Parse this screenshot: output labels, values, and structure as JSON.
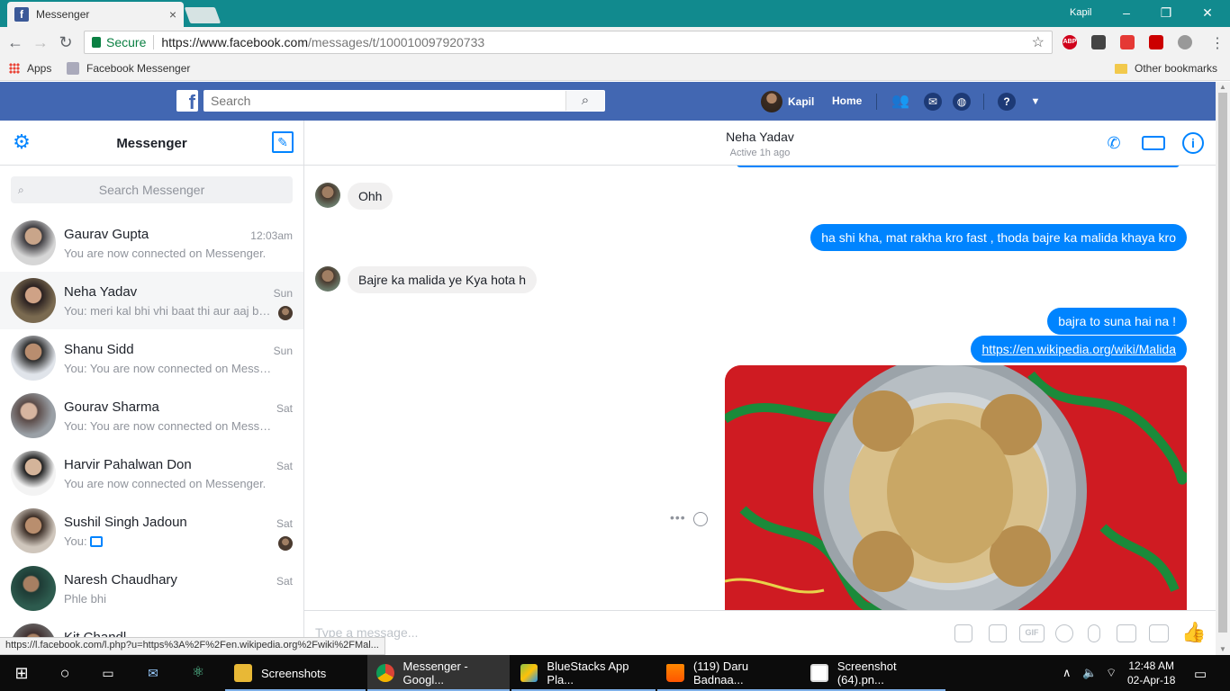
{
  "browser": {
    "tab_title": "Messenger",
    "tab_close": "×",
    "favicon": "f",
    "window_user": "Kapil",
    "secure_label": "Secure",
    "url_host": "https://www.facebook.com",
    "url_path": "/messages/t/100010097920733",
    "ext_abp": "ABP",
    "bookmarks": {
      "apps": "Apps",
      "messenger": "Facebook Messenger",
      "other": "Other bookmarks"
    }
  },
  "fb": {
    "logo": "f",
    "search_placeholder": "Search",
    "user_name": "Kapil",
    "home": "Home"
  },
  "sidebar": {
    "title": "Messenger",
    "search_placeholder": "Search Messenger",
    "conversations": [
      {
        "name": "Gaurav Gupta",
        "time": "12:03am",
        "snippet": "You are now connected on Messenger."
      },
      {
        "name": "Neha Yadav",
        "time": "Sun",
        "snippet": "You: meri kal bhi vhi baat thi aur aaj bhi..."
      },
      {
        "name": "Shanu Sidd",
        "time": "Sun",
        "snippet": "You: You are now connected on Messenger."
      },
      {
        "name": "Gourav Sharma",
        "time": "Sat",
        "snippet": "You: You are now connected on Messenger."
      },
      {
        "name": "Harvir Pahalwan Don",
        "time": "Sat",
        "snippet": "You are now connected on Messenger."
      },
      {
        "name": "Sushil Singh Jadoun",
        "time": "Sat",
        "snippet": "You:"
      },
      {
        "name": "Naresh Chaudhary",
        "time": "Sat",
        "snippet": "Phle bhi"
      },
      {
        "name": "Kit Chandl...",
        "time": "",
        "snippet": ""
      }
    ]
  },
  "chat": {
    "contact_name": "Neha Yadav",
    "status": "Active 1h ago",
    "messages": [
      {
        "dir": "in",
        "text": "Ohh"
      },
      {
        "dir": "out",
        "text": "ha shi kha, mat rakha kro fast , thoda bajre ka malida  khaya kro"
      },
      {
        "dir": "in",
        "text": "Bajre ka malida ye Kya hota h"
      },
      {
        "dir": "out",
        "text": "bajra to suna hai na !"
      },
      {
        "dir": "out",
        "text": "https://en.wikipedia.org/wiki/Malida"
      }
    ],
    "composer_placeholder": "Type a message...",
    "gif_label": "GIF"
  },
  "status_link": "https://l.facebook.com/l.php?u=https%3A%2F%2Fen.wikipedia.org%2Fwiki%2FMal...",
  "taskbar": {
    "apps": [
      {
        "label": "Screenshots"
      },
      {
        "label": "Messenger - Googl..."
      },
      {
        "label": "BlueStacks App Pla..."
      },
      {
        "label": "(119) Daru Badnaa..."
      },
      {
        "label": "Screenshot (64).pn..."
      }
    ],
    "time": "12:48 AM",
    "date": "02-Apr-18"
  },
  "colors": {
    "fb_blue": "#4267b2",
    "messenger_blue": "#0084ff",
    "chrome_teal": "#118a8e"
  }
}
